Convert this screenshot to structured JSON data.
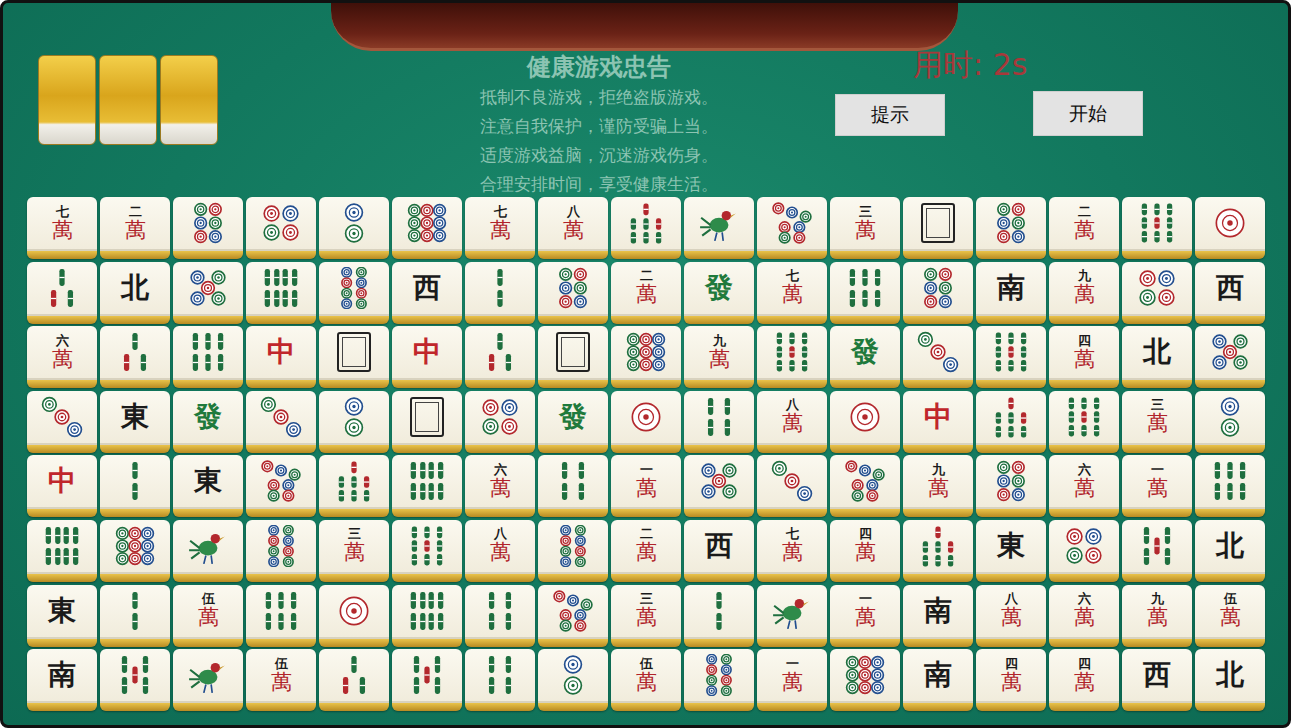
{
  "header": {
    "hint_tiles": 3,
    "notice": {
      "title": "健康游戏忠告",
      "lines": [
        "抵制不良游戏，拒绝盗版游戏。",
        "注意自我保护，谨防受骗上当。",
        "适度游戏益脑，沉迷游戏伤身。",
        "合理安排时间，享受健康生活。"
      ]
    },
    "timer": "用时: 2s",
    "buttons": [
      {
        "label": "提示"
      },
      {
        "label": "开始"
      }
    ]
  },
  "board": {
    "rows": [
      [
        {
          "kind": "wan",
          "rank": "七",
          "suit": "萬"
        },
        {
          "kind": "wan",
          "rank": "二",
          "suit": "萬"
        },
        {
          "kind": "dots",
          "count": 6
        },
        {
          "kind": "dots",
          "count": 4
        },
        {
          "kind": "dots",
          "count": 2
        },
        {
          "kind": "dots",
          "count": 9
        },
        {
          "kind": "wan",
          "rank": "七",
          "suit": "萬"
        },
        {
          "kind": "wan",
          "rank": "八",
          "suit": "萬"
        },
        {
          "kind": "bamboo",
          "count": 7
        },
        {
          "kind": "bird"
        },
        {
          "kind": "dots",
          "count": 7
        },
        {
          "kind": "wan",
          "rank": "三",
          "suit": "萬"
        },
        {
          "kind": "white"
        },
        {
          "kind": "dots",
          "count": 6
        },
        {
          "kind": "wan",
          "rank": "二",
          "suit": "萬"
        },
        {
          "kind": "bamboo",
          "count": 9
        },
        {
          "kind": "dots",
          "count": 1
        }
      ],
      [
        {
          "kind": "bamboo",
          "count": 3
        },
        {
          "kind": "honor",
          "label": "北",
          "color": "#1a1a1a"
        },
        {
          "kind": "dots",
          "count": 5
        },
        {
          "kind": "bamboo",
          "count": 8
        },
        {
          "kind": "dots",
          "count": 8
        },
        {
          "kind": "honor",
          "label": "西",
          "color": "#1a1a1a"
        },
        {
          "kind": "bamboo",
          "count": 2
        },
        {
          "kind": "dots",
          "count": 6
        },
        {
          "kind": "wan",
          "rank": "二",
          "suit": "萬"
        },
        {
          "kind": "honor",
          "label": "發",
          "color": "#1f7a3c"
        },
        {
          "kind": "wan",
          "rank": "七",
          "suit": "萬"
        },
        {
          "kind": "bamboo",
          "count": 6
        },
        {
          "kind": "dots",
          "count": 6
        },
        {
          "kind": "honor",
          "label": "南",
          "color": "#1a1a1a"
        },
        {
          "kind": "wan",
          "rank": "九",
          "suit": "萬"
        },
        {
          "kind": "dots",
          "count": 4
        },
        {
          "kind": "honor",
          "label": "西",
          "color": "#1a1a1a"
        }
      ],
      [
        {
          "kind": "wan",
          "rank": "六",
          "suit": "萬"
        },
        {
          "kind": "bamboo",
          "count": 3
        },
        {
          "kind": "bamboo",
          "count": 6
        },
        {
          "kind": "honor",
          "label": "中",
          "color": "#c0262b"
        },
        {
          "kind": "white"
        },
        {
          "kind": "honor",
          "label": "中",
          "color": "#c0262b"
        },
        {
          "kind": "bamboo",
          "count": 3
        },
        {
          "kind": "white"
        },
        {
          "kind": "dots",
          "count": 9
        },
        {
          "kind": "wan",
          "rank": "九",
          "suit": "萬"
        },
        {
          "kind": "bamboo",
          "count": 9
        },
        {
          "kind": "honor",
          "label": "發",
          "color": "#1f7a3c"
        },
        {
          "kind": "dots",
          "count": 3
        },
        {
          "kind": "bamboo",
          "count": 9
        },
        {
          "kind": "wan",
          "rank": "四",
          "suit": "萬"
        },
        {
          "kind": "honor",
          "label": "北",
          "color": "#1a1a1a"
        },
        {
          "kind": "dots",
          "count": 5
        }
      ],
      [
        {
          "kind": "dots",
          "count": 3
        },
        {
          "kind": "honor",
          "label": "東",
          "color": "#1a1a1a"
        },
        {
          "kind": "honor",
          "label": "發",
          "color": "#1f7a3c"
        },
        {
          "kind": "dots",
          "count": 3
        },
        {
          "kind": "dots",
          "count": 2
        },
        {
          "kind": "white"
        },
        {
          "kind": "dots",
          "count": 4
        },
        {
          "kind": "honor",
          "label": "發",
          "color": "#1f7a3c"
        },
        {
          "kind": "dots",
          "count": 1
        },
        {
          "kind": "bamboo",
          "count": 4
        },
        {
          "kind": "wan",
          "rank": "八",
          "suit": "萬"
        },
        {
          "kind": "dots",
          "count": 1
        },
        {
          "kind": "honor",
          "label": "中",
          "color": "#c0262b"
        },
        {
          "kind": "bamboo",
          "count": 7
        },
        {
          "kind": "bamboo",
          "count": 9
        },
        {
          "kind": "wan",
          "rank": "三",
          "suit": "萬"
        },
        {
          "kind": "dots",
          "count": 2
        }
      ],
      [
        {
          "kind": "honor",
          "label": "中",
          "color": "#c0262b"
        },
        {
          "kind": "bamboo",
          "count": 2
        },
        {
          "kind": "honor",
          "label": "東",
          "color": "#1a1a1a"
        },
        {
          "kind": "dots",
          "count": 7
        },
        {
          "kind": "bamboo",
          "count": 7
        },
        {
          "kind": "bamboo",
          "count": 8
        },
        {
          "kind": "wan",
          "rank": "六",
          "suit": "萬"
        },
        {
          "kind": "bamboo",
          "count": 4
        },
        {
          "kind": "wan",
          "rank": "一",
          "suit": "萬"
        },
        {
          "kind": "dots",
          "count": 5
        },
        {
          "kind": "dots",
          "count": 3
        },
        {
          "kind": "dots",
          "count": 7
        },
        {
          "kind": "wan",
          "rank": "九",
          "suit": "萬"
        },
        {
          "kind": "dots",
          "count": 6
        },
        {
          "kind": "wan",
          "rank": "六",
          "suit": "萬"
        },
        {
          "kind": "wan",
          "rank": "一",
          "suit": "萬"
        },
        {
          "kind": "bamboo",
          "count": 6
        }
      ],
      [
        {
          "kind": "bamboo",
          "count": 8
        },
        {
          "kind": "dots",
          "count": 9
        },
        {
          "kind": "bird"
        },
        {
          "kind": "dots",
          "count": 8
        },
        {
          "kind": "wan",
          "rank": "三",
          "suit": "萬"
        },
        {
          "kind": "bamboo",
          "count": 9
        },
        {
          "kind": "wan",
          "rank": "八",
          "suit": "萬"
        },
        {
          "kind": "dots",
          "count": 8
        },
        {
          "kind": "wan",
          "rank": "二",
          "suit": "萬"
        },
        {
          "kind": "honor",
          "label": "西",
          "color": "#1a1a1a"
        },
        {
          "kind": "wan",
          "rank": "七",
          "suit": "萬"
        },
        {
          "kind": "wan",
          "rank": "四",
          "suit": "萬"
        },
        {
          "kind": "bamboo",
          "count": 7
        },
        {
          "kind": "honor",
          "label": "東",
          "color": "#1a1a1a"
        },
        {
          "kind": "dots",
          "count": 4
        },
        {
          "kind": "bamboo",
          "count": 5
        },
        {
          "kind": "honor",
          "label": "北",
          "color": "#1a1a1a"
        }
      ],
      [
        {
          "kind": "honor",
          "label": "東",
          "color": "#1a1a1a"
        },
        {
          "kind": "bamboo",
          "count": 2
        },
        {
          "kind": "wan",
          "rank": "伍",
          "suit": "萬"
        },
        {
          "kind": "bamboo",
          "count": 6
        },
        {
          "kind": "dots",
          "count": 1
        },
        {
          "kind": "bamboo",
          "count": 8
        },
        {
          "kind": "bamboo",
          "count": 4
        },
        {
          "kind": "dots",
          "count": 7
        },
        {
          "kind": "wan",
          "rank": "三",
          "suit": "萬"
        },
        {
          "kind": "bamboo",
          "count": 2
        },
        {
          "kind": "bird"
        },
        {
          "kind": "wan",
          "rank": "一",
          "suit": "萬"
        },
        {
          "kind": "honor",
          "label": "南",
          "color": "#1a1a1a"
        },
        {
          "kind": "wan",
          "rank": "八",
          "suit": "萬"
        },
        {
          "kind": "wan",
          "rank": "六",
          "suit": "萬"
        },
        {
          "kind": "wan",
          "rank": "九",
          "suit": "萬"
        },
        {
          "kind": "wan",
          "rank": "伍",
          "suit": "萬"
        }
      ],
      [
        {
          "kind": "honor",
          "label": "南",
          "color": "#1a1a1a"
        },
        {
          "kind": "bamboo",
          "count": 5
        },
        {
          "kind": "bird"
        },
        {
          "kind": "wan",
          "rank": "伍",
          "suit": "萬"
        },
        {
          "kind": "bamboo",
          "count": 3
        },
        {
          "kind": "bamboo",
          "count": 5
        },
        {
          "kind": "bamboo",
          "count": 4
        },
        {
          "kind": "dots",
          "count": 2
        },
        {
          "kind": "wan",
          "rank": "伍",
          "suit": "萬"
        },
        {
          "kind": "dots",
          "count": 8
        },
        {
          "kind": "wan",
          "rank": "一",
          "suit": "萬"
        },
        {
          "kind": "dots",
          "count": 9
        },
        {
          "kind": "honor",
          "label": "南",
          "color": "#1a1a1a"
        },
        {
          "kind": "wan",
          "rank": "四",
          "suit": "萬"
        },
        {
          "kind": "wan",
          "rank": "四",
          "suit": "萬"
        },
        {
          "kind": "honor",
          "label": "西",
          "color": "#1a1a1a"
        },
        {
          "kind": "honor",
          "label": "北",
          "color": "#1a1a1a"
        }
      ]
    ]
  }
}
